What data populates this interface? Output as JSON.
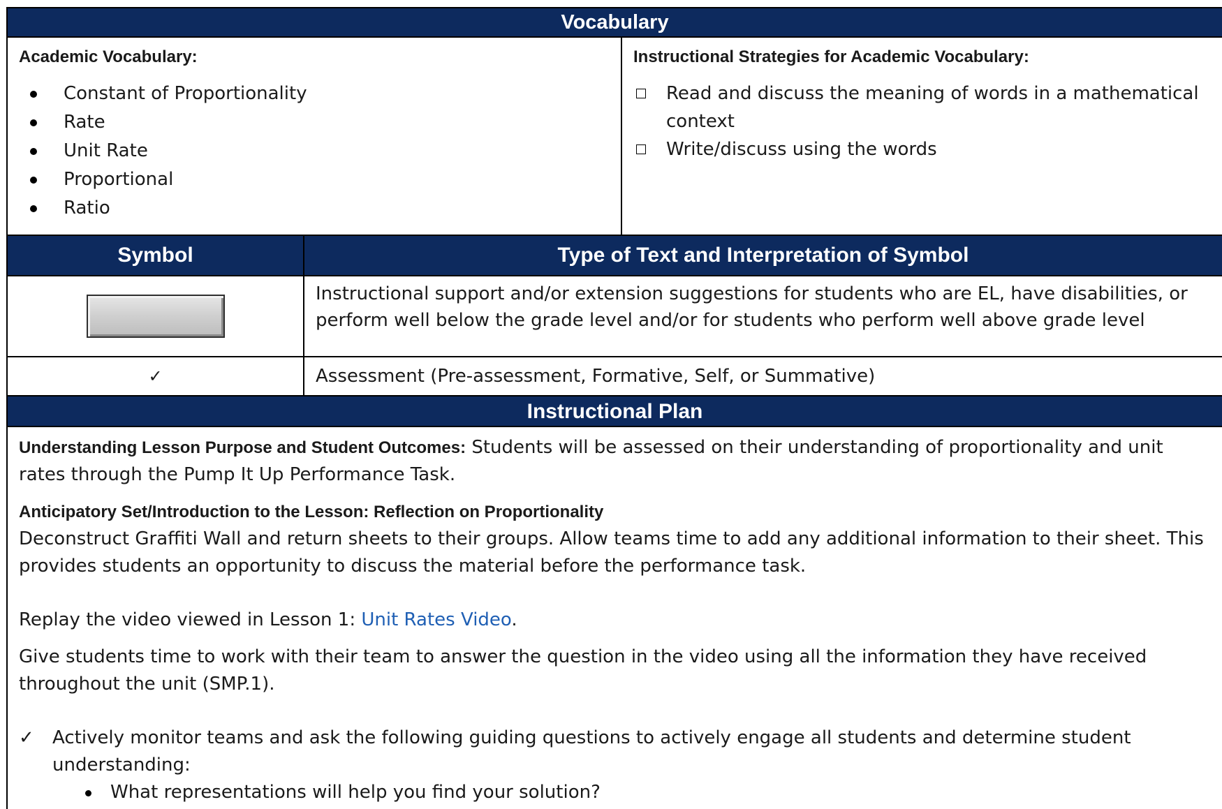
{
  "vocabulary": {
    "title": "Vocabulary",
    "academic_heading": "Academic Vocabulary:",
    "terms": [
      "Constant of Proportionality",
      "Rate",
      "Unit Rate",
      "Proportional",
      "Ratio"
    ],
    "strategies_heading": "Instructional Strategies for Academic Vocabulary:",
    "strategies": [
      "Read and discuss the meaning of words in a mathematical context",
      "Write/discuss using the words"
    ]
  },
  "symbols": {
    "col_symbol": "Symbol",
    "col_type": "Type of Text and Interpretation of Symbol",
    "rows": [
      {
        "symbol_icon": "gray-button-icon",
        "text": "Instructional support and/or extension suggestions for students who are EL, have disabilities, or perform well below the grade level and/or for students who perform well above grade level"
      },
      {
        "symbol_icon": "checkmark-icon",
        "symbol_glyph": "✓",
        "text": "Assessment (Pre-assessment, Formative, Self, or Summative)"
      }
    ]
  },
  "plan": {
    "title": "Instructional Plan",
    "purpose_label": "Understanding Lesson Purpose and Student Outcomes:",
    "purpose_text": " Students will be assessed on their understanding of proportionality and unit rates through the Pump It Up Performance Task.",
    "anticipatory_heading": "Anticipatory Set/Introduction to the Lesson: Reflection on Proportionality",
    "anticipatory_text": "Deconstruct Graffiti Wall and return sheets to their groups. Allow teams time to add any additional information to their sheet. This provides students an opportunity to discuss the material before the performance task.",
    "replay_prefix": "Replay the video viewed in Lesson 1: ",
    "replay_link": "Unit Rates Video",
    "replay_suffix": ".",
    "give_time_text": "Give students time to work with their team to answer the question in the video using all the information they have received throughout the unit (SMP.1).",
    "check_glyph": "✓",
    "monitor_text": "Actively monitor teams and ask the following guiding questions to actively engage all students and determine student understanding:",
    "questions": [
      "What representations will help you find your solution?"
    ]
  },
  "colors": {
    "header_navy": "#0d2a5e",
    "link_blue": "#1f5fb4"
  }
}
